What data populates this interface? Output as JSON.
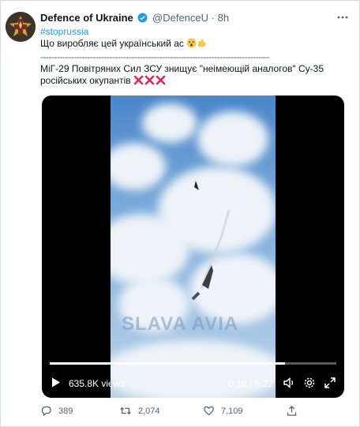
{
  "tweet": {
    "author_name": "Defence of Ukraine",
    "handle": "@DefenceU",
    "separator": "·",
    "time": "8h",
    "hashtag": "#stoprussia",
    "line1": "Що виробляє цей український ас",
    "divider": "-----------------------------------------------------------------------------------",
    "line3": "МіГ-29 Повітряних Сил ЗСУ знищує \"неімеющій аналогов\" Су-35",
    "line4": "російських окупантів"
  },
  "video": {
    "views": "635.8K views",
    "time": "0:18 / 0:22",
    "watermark": "SLAVA AVIA",
    "progress": 0.82
  },
  "actions": {
    "replies": "389",
    "retweets": "2,074",
    "likes": "7,109"
  },
  "colors": {
    "accent": "#1d9bf0",
    "muted": "#536471",
    "cross": "#e0245e"
  },
  "icons": [
    "emblem-avatar",
    "verified-badge-icon",
    "more-icon",
    "face-emoji-icon",
    "flexed-arm-emoji-icon",
    "cross-mark-icon",
    "play-icon",
    "volume-icon",
    "gear-icon",
    "fullscreen-icon",
    "reply-icon",
    "retweet-icon",
    "like-icon",
    "share-icon"
  ]
}
